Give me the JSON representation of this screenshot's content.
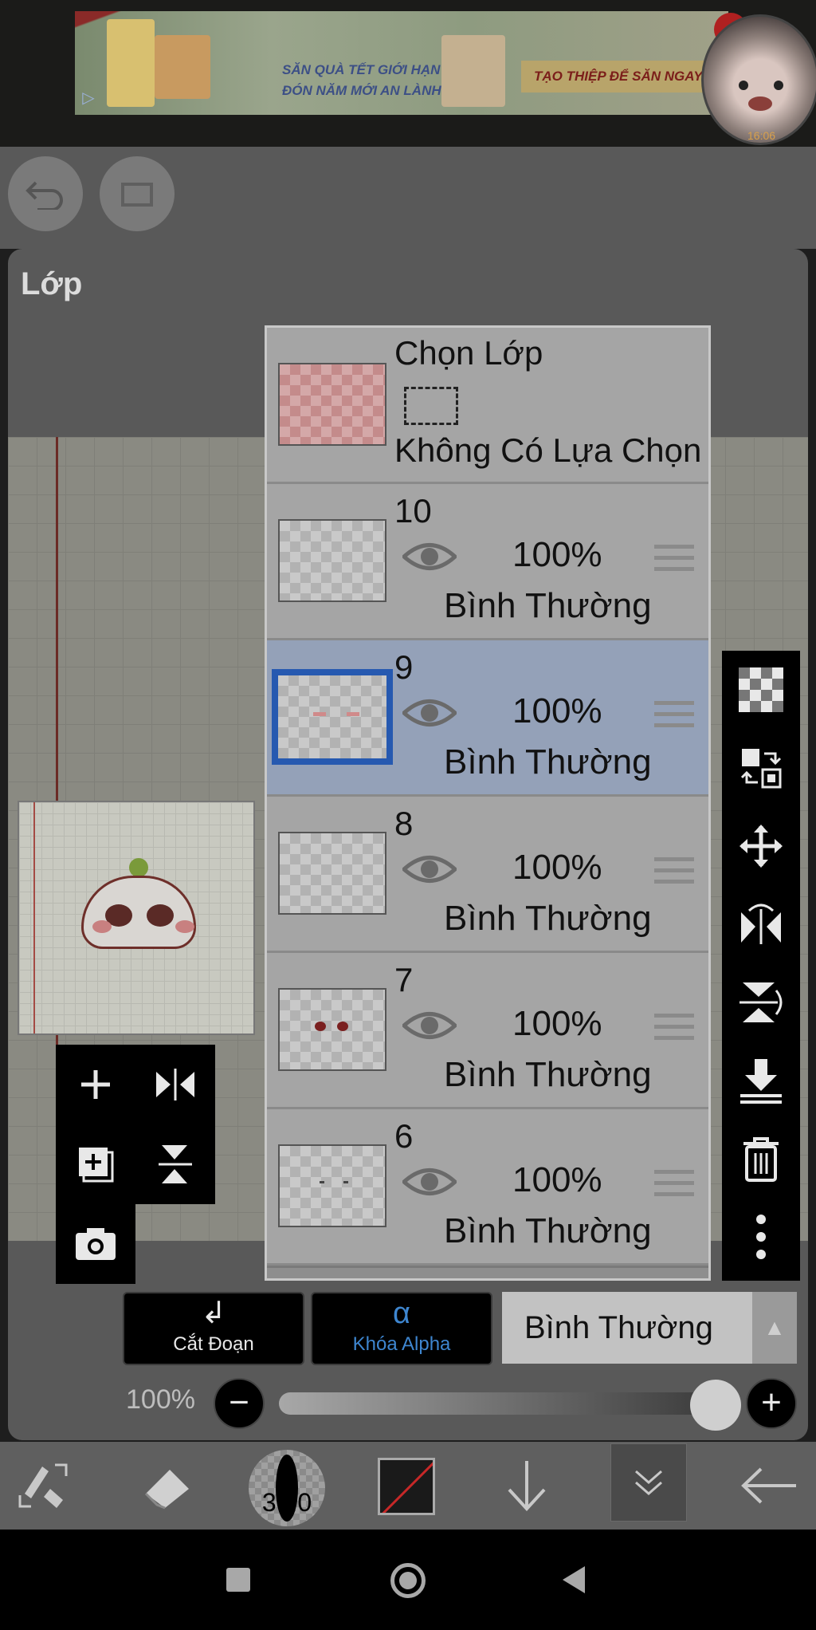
{
  "ad": {
    "line1": "SĂN QUÀ TẾT GIỚI HẠN",
    "line2": "ĐÓN NĂM MỚI AN LÀNH",
    "cta": "TẠO THIỆP ĐỂ SĂN NGAY",
    "info_icon": "ad-info-icon"
  },
  "bubble": {
    "time": "16:06"
  },
  "panel": {
    "title": "Lớp"
  },
  "selection_layer": {
    "title": "Chọn Lớp",
    "status": "Không Có Lựa Chọn"
  },
  "layers": [
    {
      "number": "10",
      "opacity": "100%",
      "blend": "Bình Thường",
      "visible": true,
      "selected": false
    },
    {
      "number": "9",
      "opacity": "100%",
      "blend": "Bình Thường",
      "visible": true,
      "selected": true
    },
    {
      "number": "8",
      "opacity": "100%",
      "blend": "Bình Thường",
      "visible": true,
      "selected": false
    },
    {
      "number": "7",
      "opacity": "100%",
      "blend": "Bình Thường",
      "visible": true,
      "selected": false
    },
    {
      "number": "6",
      "opacity": "100%",
      "blend": "Bình Thường",
      "visible": true,
      "selected": false
    }
  ],
  "controls": {
    "clip_label": "Cắt Đoạn",
    "alpha_label": "Khóa Alpha",
    "alpha_icon": "α",
    "blend_mode": "Bình Thường",
    "opacity_label": "100%",
    "opacity_value": 1.0
  },
  "toolbar": {
    "brush_size": "30.0",
    "colors": {
      "accent_blue": "#2659b0",
      "alpha_blue": "#3e86d0",
      "stroke_red": "#c62828"
    }
  },
  "icons": {
    "left": [
      "add-icon",
      "flip-horizontal-icon",
      "duplicate-icon",
      "flip-vertical-icon",
      "camera-icon"
    ],
    "right": [
      "transparent-icon",
      "swap-layers-icon",
      "move-icon",
      "flip-horizontal-icon",
      "flip-vertical-icon",
      "merge-down-icon",
      "trash-icon",
      "more-icon"
    ],
    "bottom": [
      "transform-icon",
      "eraser-icon",
      "brush-size-icon",
      "color-icon",
      "arrow-down-icon",
      "collapse-icon",
      "back-arrow-icon"
    ]
  }
}
